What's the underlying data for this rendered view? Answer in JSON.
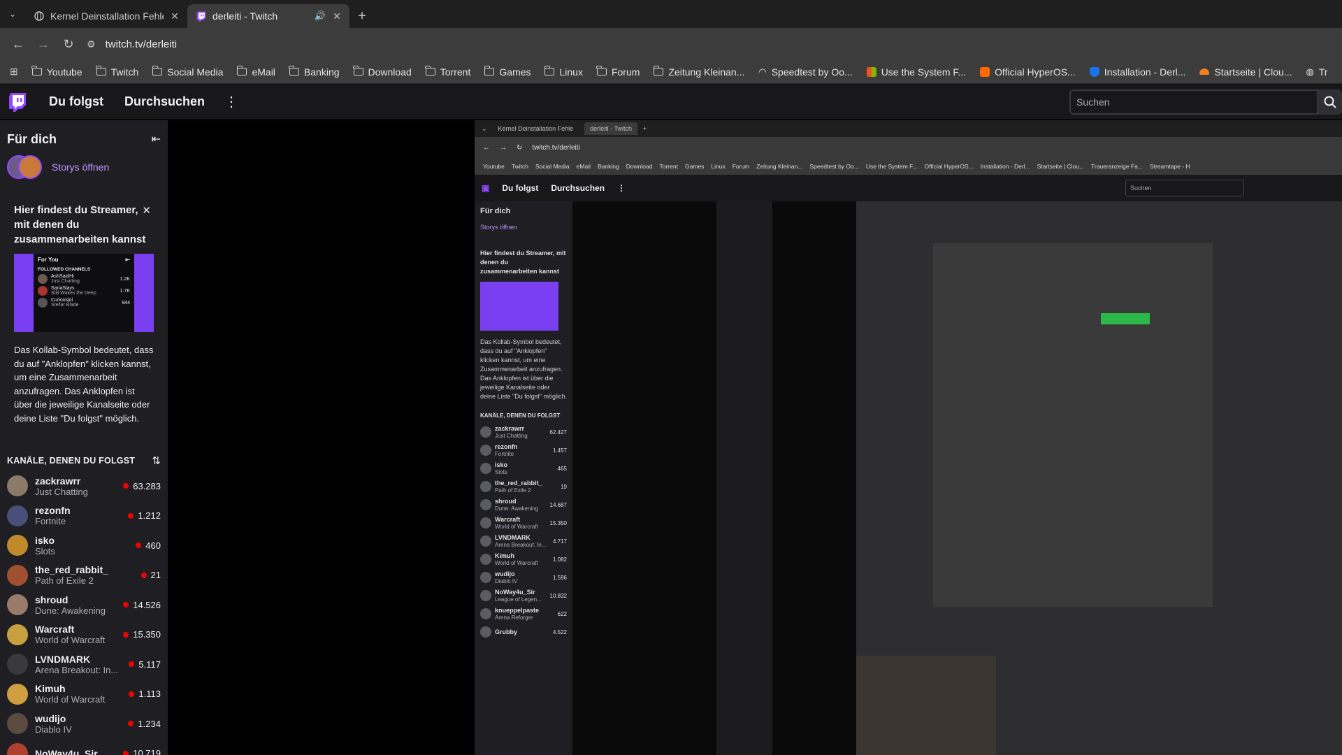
{
  "browser": {
    "tabs": [
      {
        "title": "Kernel Deinstallation Fehle",
        "active": false
      },
      {
        "title": "derleiti - Twitch",
        "active": true
      }
    ],
    "url": "twitch.tv/derleiti",
    "bookmarks": [
      {
        "label": "Youtube",
        "icon": "folder-icon"
      },
      {
        "label": "Twitch",
        "icon": "folder-icon"
      },
      {
        "label": "Social Media",
        "icon": "folder-icon"
      },
      {
        "label": "eMail",
        "icon": "folder-icon"
      },
      {
        "label": "Banking",
        "icon": "folder-icon"
      },
      {
        "label": "Download",
        "icon": "folder-icon"
      },
      {
        "label": "Torrent",
        "icon": "folder-icon"
      },
      {
        "label": "Games",
        "icon": "folder-icon"
      },
      {
        "label": "Linux",
        "icon": "folder-icon"
      },
      {
        "label": "Forum",
        "icon": "folder-icon"
      },
      {
        "label": "Zeitung Kleinan...",
        "icon": "folder-icon"
      },
      {
        "label": "Speedtest by Oo...",
        "icon": "speedtest-icon"
      },
      {
        "label": "Use the System F...",
        "icon": "windows-icon"
      },
      {
        "label": "Official HyperOS...",
        "icon": "hyperos-icon"
      },
      {
        "label": "Installation - Derl...",
        "icon": "shield-icon"
      },
      {
        "label": "Startseite | Clou...",
        "icon": "cloudflare-icon"
      },
      {
        "label": "Tr",
        "icon": "globe-icon"
      }
    ]
  },
  "twitch": {
    "nav": {
      "following": "Du folgst",
      "browse": "Durchsuchen"
    },
    "search": {
      "placeholder": "Suchen"
    },
    "sidebar": {
      "title": "Für dich",
      "stories_label": "Storys öffnen",
      "promo": {
        "title": "Hier findest du Streamer, mit denen du zusammenarbeiten kannst",
        "preview": {
          "heading": "For You",
          "section": "FOLLOWED CHANNELS",
          "rows": [
            {
              "name": "AshSaidHi",
              "game": "Just Chatting",
              "viewers": "1.2K"
            },
            {
              "name": "SariaSlays",
              "game": "Still Wakes the Deep",
              "viewers": "1.7K"
            },
            {
              "name": "Curiousjoi",
              "game": "Stellar Blade",
              "viewers": "944"
            }
          ]
        },
        "body": "Das Kollab-Symbol bedeutet, dass du auf \"Anklopfen\" klicken kannst, um eine Zusammenarbeit anzufragen. Das Anklopfen ist über die jeweilige Kanalseite oder deine Liste \"Du folgst\" möglich."
      },
      "followed_header": "KANÄLE, DENEN DU FOLGST",
      "channels": [
        {
          "name": "zackrawrr",
          "game": "Just Chatting",
          "viewers": "63.283",
          "color": "#8a7a6a"
        },
        {
          "name": "rezonfn",
          "game": "Fortnite",
          "viewers": "1.212",
          "color": "#4a4f7a"
        },
        {
          "name": "isko",
          "game": "Slots",
          "viewers": "460",
          "color": "#c08a2a"
        },
        {
          "name": "the_red_rabbit_",
          "game": "Path of Exile 2",
          "viewers": "21",
          "color": "#a05030"
        },
        {
          "name": "shroud",
          "game": "Dune: Awakening",
          "viewers": "14.526",
          "color": "#9a7a6a"
        },
        {
          "name": "Warcraft",
          "game": "World of Warcraft",
          "viewers": "15.350",
          "color": "#c8a040"
        },
        {
          "name": "LVNDMARK",
          "game": "Arena Breakout: In...",
          "viewers": "5.117",
          "color": "#3a3a3a"
        },
        {
          "name": "Kimuh",
          "game": "World of Warcraft",
          "viewers": "1.113",
          "color": "#d0a040"
        },
        {
          "name": "wudijo",
          "game": "Diablo IV",
          "viewers": "1.234",
          "color": "#5a4a40"
        },
        {
          "name": "NoWay4u_Sir",
          "game": "",
          "viewers": "10.719",
          "color": "#b04030"
        }
      ]
    },
    "stream_mirror": {
      "tabs": [
        "Kernel Deinstallation Fehle",
        "derleiti - Twitch"
      ],
      "url": "twitch.tv/derleiti",
      "bookmarks": [
        "Youtube",
        "Twitch",
        "Social Media",
        "eMail",
        "Banking",
        "Download",
        "Torrent",
        "Games",
        "Linux",
        "Forum",
        "Zeitung Kleinan...",
        "Speedtest by Oo...",
        "Use the System F...",
        "Official HyperOS...",
        "Installation - Derl...",
        "Startseite | Clou...",
        "Traueranzeige Fa...",
        "Streamtape - H"
      ],
      "nav_following": "Du folgst",
      "nav_browse": "Durchsuchen",
      "search": "Suchen",
      "sidebar_title": "Für dich",
      "stories": "Storys öffnen",
      "promo_title": "Hier findest du Streamer, mit denen du zusammenarbeiten kannst",
      "promo_body": "Das Kollab-Symbol bedeutet, dass du auf \"Anklopfen\" klicken kannst, um eine Zusammenarbeit anzufragen. Das Anklopfen ist über die jeweilige Kanalseite oder deine Liste \"Du folgst\" möglich.",
      "followed_header": "KANÄLE, DENEN DU FOLGST",
      "channels": [
        {
          "name": "zackrawrr",
          "game": "Just Chatting",
          "viewers": "62.427"
        },
        {
          "name": "rezonfn",
          "game": "Fortnite",
          "viewers": "1.457"
        },
        {
          "name": "isko",
          "game": "Slots",
          "viewers": "465"
        },
        {
          "name": "the_red_rabbit_",
          "game": "Path of Exile 2",
          "viewers": "19"
        },
        {
          "name": "shroud",
          "game": "Dune: Awakening",
          "viewers": "14.687"
        },
        {
          "name": "Warcraft",
          "game": "World of Warcraft",
          "viewers": "15.350"
        },
        {
          "name": "LVNDMARK",
          "game": "Arena Breakout: In...",
          "viewers": "4.717"
        },
        {
          "name": "Kimuh",
          "game": "World of Warcraft",
          "viewers": "1.082"
        },
        {
          "name": "wudijo",
          "game": "Diablo IV",
          "viewers": "1.596"
        },
        {
          "name": "NoWay4u_Sir",
          "game": "League of Legen...",
          "viewers": "10.832"
        },
        {
          "name": "knueppelpaste",
          "game": "Arena Reforger",
          "viewers": "622"
        },
        {
          "name": "Grubby",
          "game": "",
          "viewers": "4.522"
        }
      ]
    }
  },
  "colors": {
    "accent": "#9147ff",
    "live": "#eb0400",
    "bg": "#0e0e10",
    "sidebar": "#1f1f23"
  }
}
